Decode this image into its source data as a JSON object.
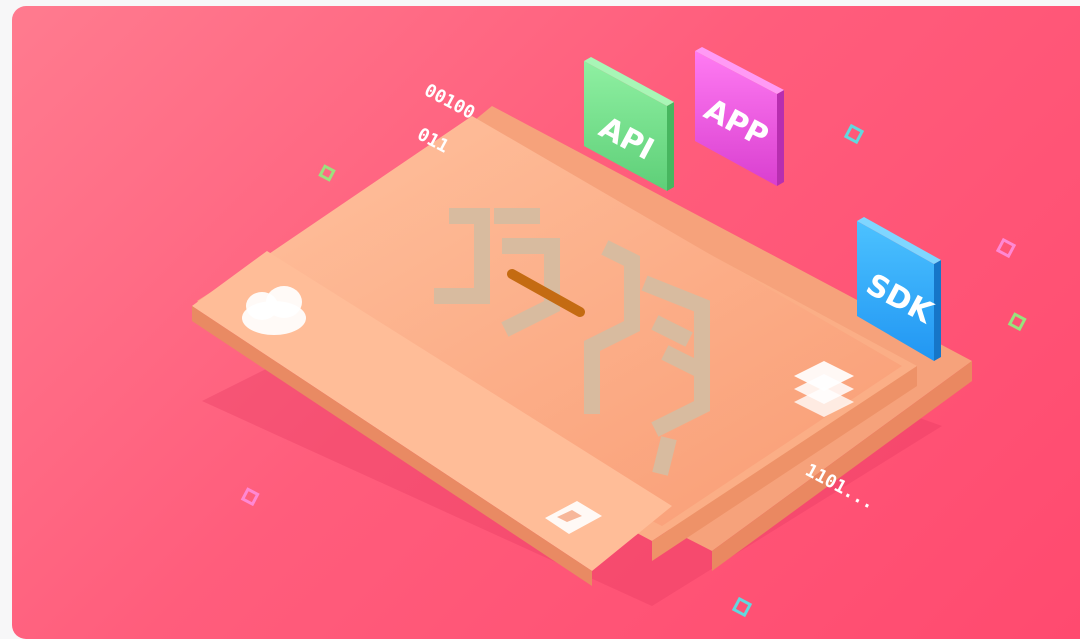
{
  "banner": {
    "colors": {
      "background_start": "#ff7b8f",
      "background_end": "#ff4a6f",
      "board": "#fba67f",
      "board_top": "#ffb48e",
      "api_badge": "#7be38f",
      "app_badge": "#f25de6",
      "sdk_badge": "#38b1ff",
      "logo_glyph": "#d8bb9f",
      "logo_accent": "#c46b12"
    },
    "binary_top_1": "00100",
    "binary_top_2": "011",
    "binary_bottom": "1101...",
    "api_label": "API",
    "app_label": "APP",
    "sdk_label": "SDK",
    "icons": [
      "cloud-icon",
      "server-icon",
      "document-icon"
    ]
  }
}
